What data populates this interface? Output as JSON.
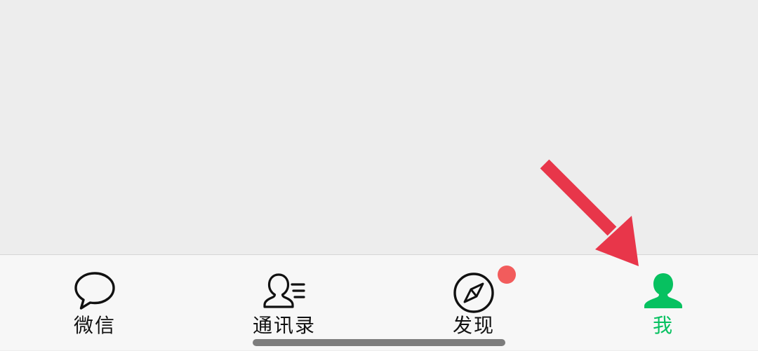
{
  "tabbar": {
    "tabs": [
      {
        "label": "微信",
        "icon": "chat-bubble-icon",
        "active": false,
        "badge": false
      },
      {
        "label": "通讯录",
        "icon": "contacts-icon",
        "active": false,
        "badge": false
      },
      {
        "label": "发现",
        "icon": "compass-icon",
        "active": false,
        "badge": true
      },
      {
        "label": "我",
        "icon": "person-icon",
        "active": true,
        "badge": false
      }
    ]
  },
  "colors": {
    "accent": "#07c160",
    "badge": "#f25c5c",
    "annotation": "#e8364a",
    "text": "#111111",
    "tabbar_bg": "#f7f7f7",
    "content_bg": "#ededed"
  }
}
